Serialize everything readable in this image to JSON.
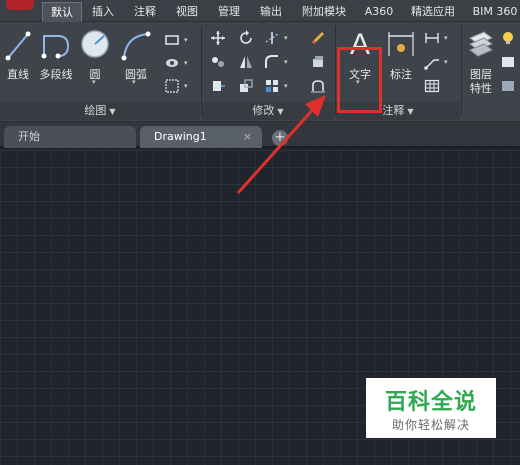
{
  "tabs": [
    {
      "label": "默认",
      "active": true
    },
    {
      "label": "插入"
    },
    {
      "label": "注释"
    },
    {
      "label": "视图"
    },
    {
      "label": "管理"
    },
    {
      "label": "输出"
    },
    {
      "label": "附加模块"
    },
    {
      "label": "A360"
    },
    {
      "label": "精选应用"
    },
    {
      "label": "BIM 360"
    }
  ],
  "ribbon": {
    "draw": {
      "buttons": [
        "直线",
        "多段线",
        "圆",
        "圆弧"
      ],
      "footer": "绘图"
    },
    "modify": {
      "footer": "修改"
    },
    "annotate": {
      "text_button": "文字",
      "dim_button": "标注",
      "footer": "注释"
    },
    "layers": {
      "button_line1": "图层",
      "button_line2": "特性"
    }
  },
  "doc_tabs": {
    "start": "开始",
    "drawing": "Drawing1",
    "close": "×",
    "new": "+"
  },
  "watermark": {
    "title": "百科全说",
    "subtitle": "助你轻松解决"
  },
  "colors": {
    "highlight": "#e0302c",
    "watermark_green": "#2fa84f"
  }
}
